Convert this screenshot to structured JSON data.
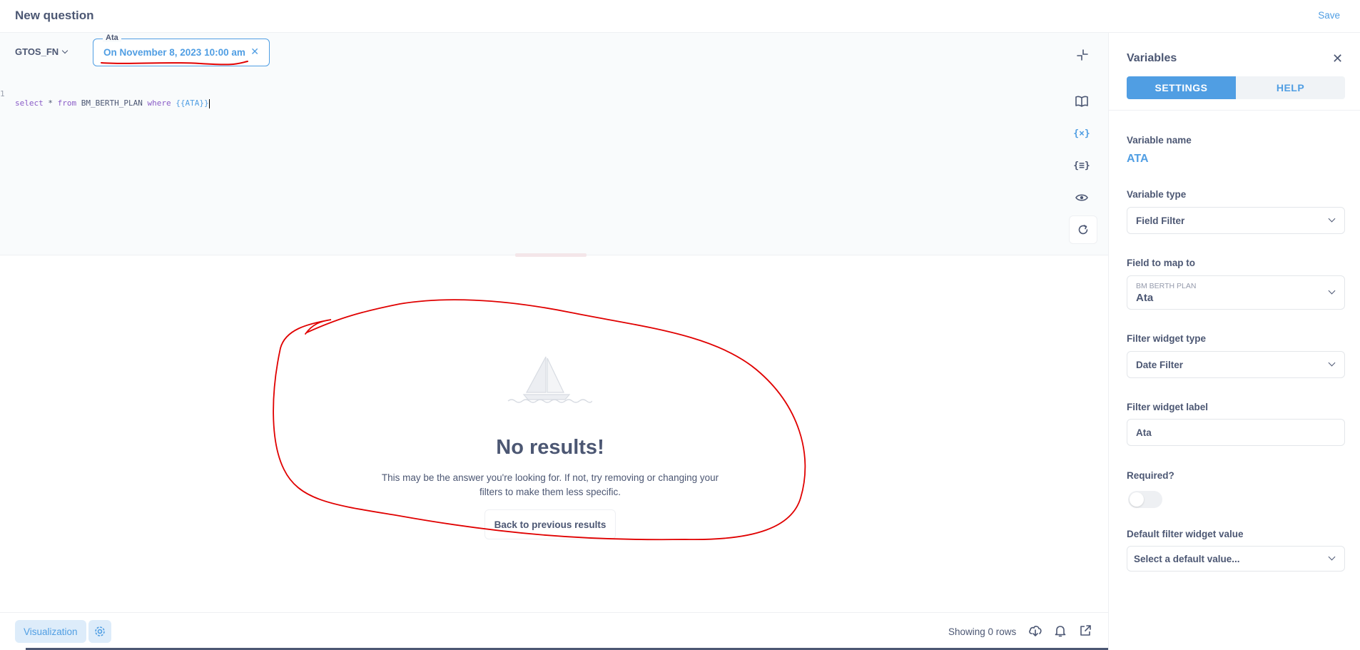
{
  "header": {
    "title": "New question",
    "save_label": "Save"
  },
  "editor": {
    "database": "GTOS_FN",
    "variable_widget": {
      "legend": "Ata",
      "value": "On November 8, 2023 10:00 am",
      "clear_icon": "close-icon"
    },
    "line_number": "1",
    "sql": {
      "kw_select": "select",
      "mid1": " * ",
      "kw_from": "from",
      "table": " BM_BERTH_PLAN ",
      "kw_where": "where",
      "space": " ",
      "tag": "{{ATA}}"
    },
    "tools": [
      "data-reference-icon",
      "variables-icon",
      "snippets-icon",
      "preview-icon",
      "run-icon"
    ]
  },
  "results": {
    "title": "No results!",
    "description": "This may be the answer you're looking for. If not, try removing or changing your filters to make them less specific.",
    "back_button": "Back to previous results"
  },
  "footer": {
    "visualization_label": "Visualization",
    "row_count": "Showing 0 rows",
    "icons": [
      "download-icon",
      "bell-icon",
      "share-icon"
    ]
  },
  "sidebar": {
    "title": "Variables",
    "tabs": [
      {
        "label": "SETTINGS",
        "active": true
      },
      {
        "label": "HELP",
        "active": false
      }
    ],
    "variable_name_label": "Variable name",
    "variable_name": "ATA",
    "variable_type_label": "Variable type",
    "variable_type": "Field Filter",
    "field_map_label": "Field to map to",
    "field_map_table": "BM BERTH PLAN",
    "field_map_field": "Ata",
    "widget_type_label": "Filter widget type",
    "widget_type": "Date Filter",
    "widget_label_label": "Filter widget label",
    "widget_label_value": "Ata",
    "required_label": "Required?",
    "required": false,
    "default_value_label": "Default filter widget value",
    "default_value_placeholder": "Select a default value..."
  },
  "colors": {
    "brand": "#509ee3",
    "text": "#4c5773",
    "annotation": "#e00000"
  }
}
